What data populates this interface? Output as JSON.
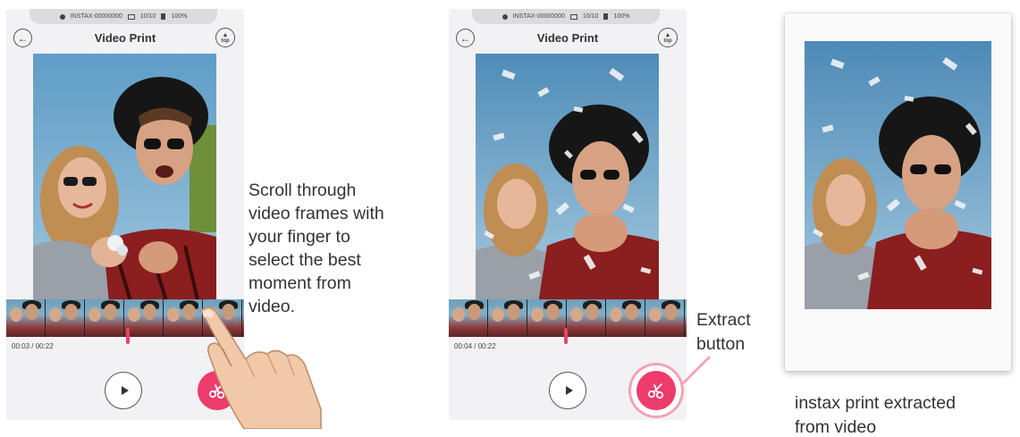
{
  "screen_left": {
    "status": {
      "device": "INSTAX-00000000",
      "film": "10/10",
      "battery": "100%"
    },
    "title": "Video Print",
    "top_button": "top",
    "time": "00:03 / 00:22",
    "playhead_fraction": 0.136
  },
  "screen_right": {
    "status": {
      "device": "INSTAX-00000000",
      "film": "10/10",
      "battery": "100%"
    },
    "title": "Video Print",
    "top_button": "top",
    "time": "00:04 / 00:22",
    "playhead_fraction": 0.18
  },
  "captions": {
    "scroll_instruction": "Scroll through\nvideo frames with\nyour finger to\nselect the best\nmoment from\nvideo.",
    "extract_button": "Extract\nbutton",
    "print_result": "instax print extracted\nfrom video"
  },
  "icons": {
    "back": "back-arrow-icon",
    "top": "top-arrow-icon",
    "play": "play-icon",
    "extract": "scissors-icon"
  },
  "colors": {
    "accent": "#ed3c6b",
    "screen_bg": "#f2f2f4",
    "status_bg": "#dcdcdf"
  }
}
